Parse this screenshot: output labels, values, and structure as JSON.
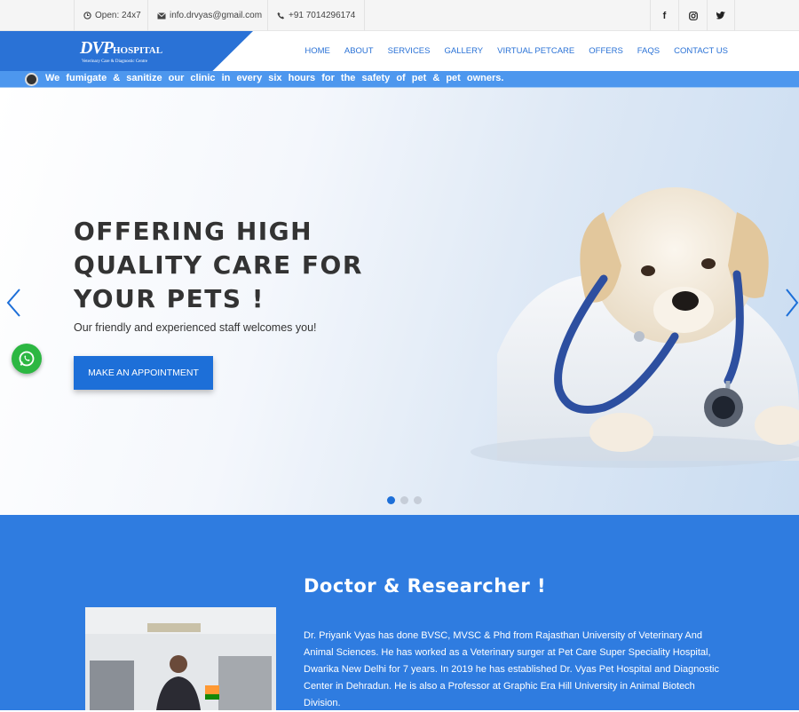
{
  "topbar": {
    "open": "Open: 24x7",
    "email": "info.drvyas@gmail.com",
    "phone": "+91 7014296174",
    "social": [
      {
        "label": "f",
        "icon": "facebook-icon"
      },
      {
        "label": "◎",
        "icon": "instagram-icon"
      },
      {
        "label": "t",
        "icon": "twitter-icon"
      }
    ]
  },
  "header": {
    "logo_mark": "DVP",
    "logo_text": "HOSPITAL",
    "logo_sub": "Veterinary Care & Diagnostic Centre",
    "nav": [
      "HOME",
      "ABOUT",
      "SERVICES",
      "GALLERY",
      "VIRTUAL PETCARE",
      "OFFERS",
      "FAQS",
      "CONTACT US"
    ]
  },
  "marquee": {
    "text": "We fumigate & sanitize our clinic in every six hours for the safety of pet & pet owners."
  },
  "hero": {
    "title_line1": "OFFERING HIGH",
    "title_line2": "QUALITY CARE FOR",
    "title_line3": "YOUR PETS !",
    "subtitle": "Our friendly and experienced staff welcomes you!",
    "cta": "MAKE AN APPOINTMENT",
    "slides": 3,
    "active_slide": 1
  },
  "about": {
    "title": "Doctor & Researcher !",
    "text": "Dr. Priyank Vyas has done BVSC, MVSC & Phd from Rajasthan University of Veterinary And Animal Sciences. He has worked as a Veterinary surger at Pet Care Super Speciality Hospital, Dwarika New Delhi for 7 years. In 2019 he has established Dr. Vyas Pet Hospital and Diagnostic Center in Dehradun. He is also a Professor at Graphic Era Hill University in Animal Biotech Division."
  },
  "colors": {
    "brand": "#2a72d6",
    "marquee": "#4d97ee",
    "about_bg": "#2f7ce0",
    "cta": "#1d6fd8",
    "whatsapp": "#2cb742"
  }
}
